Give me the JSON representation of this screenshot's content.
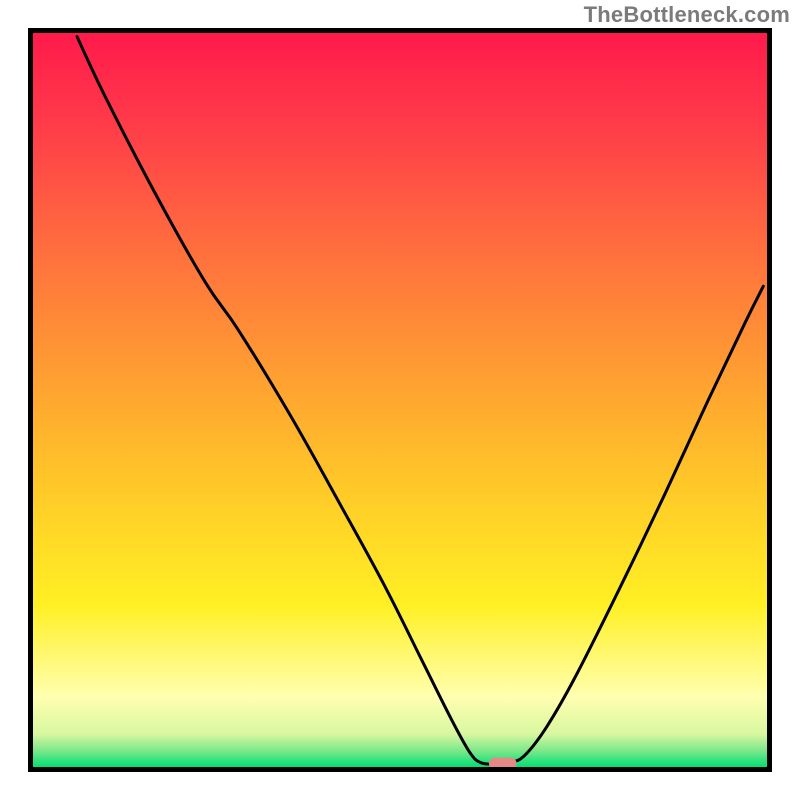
{
  "watermark": "TheBottleneck.com",
  "chart_data": {
    "type": "line",
    "title": "",
    "xlabel": "",
    "ylabel": "",
    "xlim": [
      0,
      100
    ],
    "ylim": [
      0,
      100
    ],
    "grid": false,
    "legend": false,
    "background": {
      "description": "Vertical gradient resembling a bottleneck heatmap: red at top through orange/yellow to pale-yellow, with a thin green floor band.",
      "stops": [
        {
          "offset": 0.0,
          "color": "#ff1a4b"
        },
        {
          "offset": 0.12,
          "color": "#ff3a49"
        },
        {
          "offset": 0.28,
          "color": "#ff6a3f"
        },
        {
          "offset": 0.45,
          "color": "#ff9a33"
        },
        {
          "offset": 0.62,
          "color": "#ffc928"
        },
        {
          "offset": 0.78,
          "color": "#fff024"
        },
        {
          "offset": 0.905,
          "color": "#ffffb0"
        },
        {
          "offset": 0.955,
          "color": "#d8f7a0"
        },
        {
          "offset": 0.978,
          "color": "#7be88a"
        },
        {
          "offset": 1.0,
          "color": "#00e074"
        }
      ]
    },
    "curve": {
      "description": "V-shaped bottleneck curve. Left arm starts top-left, descends steeply, bottoms out near x≈63, right arm rises toward upper-right.",
      "points": [
        {
          "x": 6.0,
          "y": 99.5
        },
        {
          "x": 10.0,
          "y": 91.0
        },
        {
          "x": 17.0,
          "y": 77.5
        },
        {
          "x": 23.5,
          "y": 66.0
        },
        {
          "x": 28.0,
          "y": 59.5
        },
        {
          "x": 35.0,
          "y": 48.0
        },
        {
          "x": 42.0,
          "y": 35.5
        },
        {
          "x": 48.0,
          "y": 24.5
        },
        {
          "x": 53.0,
          "y": 14.5
        },
        {
          "x": 57.0,
          "y": 6.5
        },
        {
          "x": 59.5,
          "y": 2.0
        },
        {
          "x": 61.0,
          "y": 0.6
        },
        {
          "x": 63.0,
          "y": 0.4
        },
        {
          "x": 65.0,
          "y": 0.6
        },
        {
          "x": 67.0,
          "y": 1.6
        },
        {
          "x": 70.0,
          "y": 5.5
        },
        {
          "x": 74.0,
          "y": 12.5
        },
        {
          "x": 80.0,
          "y": 24.5
        },
        {
          "x": 86.0,
          "y": 37.0
        },
        {
          "x": 92.0,
          "y": 50.0
        },
        {
          "x": 97.0,
          "y": 60.5
        },
        {
          "x": 99.5,
          "y": 65.5
        }
      ]
    },
    "marker": {
      "description": "Small rounded salmon-pink highlight on the green baseline indicating the optimal/balanced point.",
      "x": 64.0,
      "y": 0.0,
      "color": "#e38a86",
      "width": 3.8,
      "height": 1.6
    },
    "frame": {
      "color": "#000000",
      "width": 5
    }
  }
}
